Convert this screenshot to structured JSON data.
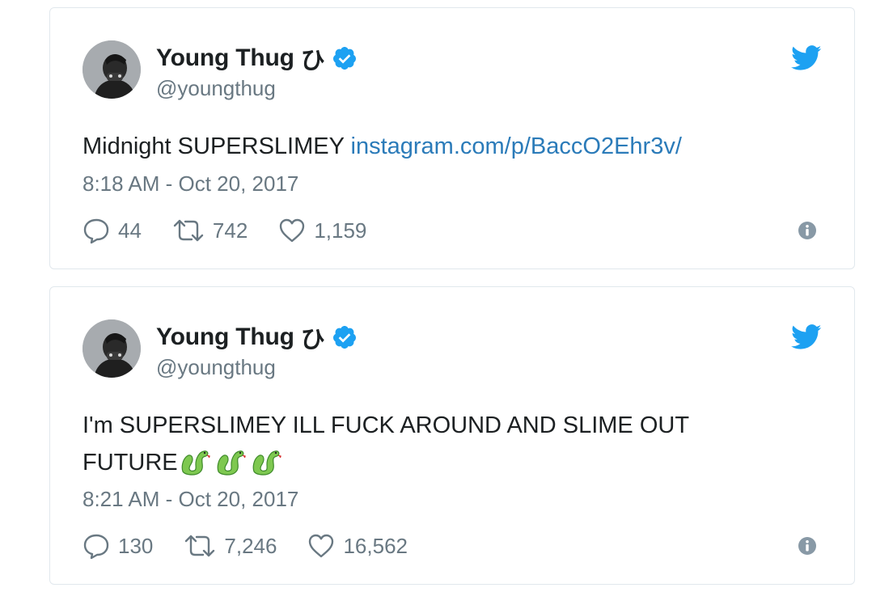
{
  "colors": {
    "verified": "#1da1f2",
    "link": "#2b7bb9",
    "meta": "#697882",
    "text": "#1c2022",
    "border": "#e1e8ed"
  },
  "tweets": [
    {
      "display_name": "Young Thug",
      "name_suffix": "ひ",
      "handle": "@youngthug",
      "text": "Midnight SUPERSLIMEY ",
      "link": "instagram.com/p/BaccO2Ehr3v/",
      "timestamp": "8:18 AM - Oct 20, 2017",
      "replies": "44",
      "retweets": "742",
      "likes": "1,159",
      "icons": [
        "avatar",
        "verified-badge-icon",
        "twitter-bird-icon",
        "reply-icon",
        "retweet-icon",
        "heart-icon",
        "info-icon"
      ]
    },
    {
      "display_name": "Young Thug",
      "name_suffix": "ひ",
      "handle": "@youngthug",
      "text_line1": "I'm SUPERSLIMEY ILL FUCK AROUND AND SLIME OUT",
      "text_line2": "FUTURE",
      "emojis": [
        "snake-emoji",
        "snake-emoji",
        "snake-emoji"
      ],
      "timestamp": "8:21 AM - Oct 20, 2017",
      "replies": "130",
      "retweets": "7,246",
      "likes": "16,562",
      "icons": [
        "avatar",
        "verified-badge-icon",
        "twitter-bird-icon",
        "reply-icon",
        "retweet-icon",
        "heart-icon",
        "info-icon"
      ]
    }
  ]
}
